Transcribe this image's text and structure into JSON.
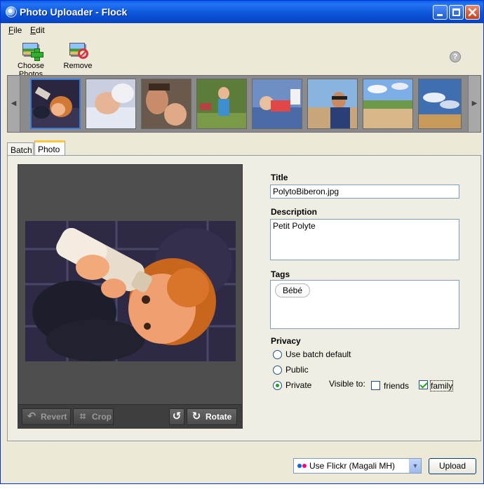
{
  "window": {
    "title": "Photo Uploader - Flock",
    "app_icon": "flock-globe-icon",
    "controls": [
      "minimize",
      "maximize",
      "close"
    ]
  },
  "menu": [
    {
      "label": "File",
      "mnemonic": "F",
      "rest": "ile"
    },
    {
      "label": "Edit",
      "mnemonic": "E",
      "rest": "dit"
    }
  ],
  "toolbar": {
    "choose_label": "Choose Photos",
    "remove_label": "Remove",
    "help_icon": "help-icon",
    "help_glyph": "?"
  },
  "strip": {
    "left_arrow": "◀",
    "right_arrow": "▶",
    "thumbnails": [
      {
        "selected": true
      },
      {
        "selected": false
      },
      {
        "selected": false
      },
      {
        "selected": false
      },
      {
        "selected": false
      },
      {
        "selected": false
      },
      {
        "selected": false
      },
      {
        "selected": false
      }
    ]
  },
  "tabs": [
    {
      "label": "Batch",
      "active": false
    },
    {
      "label": "Photo",
      "active": true
    }
  ],
  "preview": {
    "revert_label": "Revert",
    "crop_label": "Crop",
    "rotate_label": "Rotate",
    "revert_glyph": "↶",
    "crop_glyph": "⌗",
    "rotate_left_glyph": "↺",
    "rotate_glyph": "↻"
  },
  "form": {
    "title_label": "Title",
    "title_value": "PolytoBiberon.jpg",
    "description_label": "Description",
    "description_value": "Petit Polyte",
    "tags_label": "Tags",
    "tags": [
      "Bébé"
    ],
    "privacy_label": "Privacy",
    "privacy_options": [
      {
        "label": "Use batch default",
        "checked": false
      },
      {
        "label": "Public",
        "checked": false
      },
      {
        "label": "Private",
        "checked": true
      }
    ],
    "visible_to_label": "Visible to:",
    "visible_to": [
      {
        "label": "friends",
        "checked": false
      },
      {
        "label": "family",
        "checked": true
      }
    ]
  },
  "footer": {
    "account_selected": "Use Flickr (Magali MH)",
    "dropdown_arrow": "▼",
    "upload_label": "Upload"
  }
}
